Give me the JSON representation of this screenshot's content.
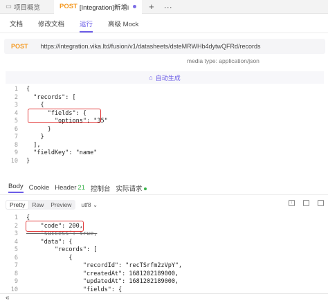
{
  "tabs": [
    {
      "label": "项目概览"
    },
    {
      "method": "POST",
      "label": "[Integration]新增i"
    }
  ],
  "tabbar": {
    "plus": "+",
    "more": "···"
  },
  "subnav": [
    "文档",
    "修改文档",
    "运行",
    "高级 Mock"
  ],
  "request": {
    "method": "POST",
    "url": "https://integration.vika.ltd/fusion/v1/datasheets/dsteMRWHb4dytwQFRd/records",
    "media_type": "media type: application/json",
    "autogen": "自动生成"
  },
  "request_body": [
    {
      "n": "1",
      "t": "{"
    },
    {
      "n": "2",
      "t": "  \"records\": ["
    },
    {
      "n": "3",
      "t": "    {"
    },
    {
      "n": "4",
      "t": "      \"fields\": {"
    },
    {
      "n": "5",
      "t": "        \"options\": \"35\""
    },
    {
      "n": "6",
      "t": "      }"
    },
    {
      "n": "7",
      "t": "    }"
    },
    {
      "n": "8",
      "t": "  ],"
    },
    {
      "n": "9",
      "t": "  \"fieldKey\": \"name\""
    },
    {
      "n": "10",
      "t": "}"
    }
  ],
  "response_tabs": [
    "Body",
    "Cookie",
    "Header",
    "21",
    "控制台",
    "实际请求"
  ],
  "view_modes": [
    "Pretty",
    "Raw",
    "Preview"
  ],
  "encoding": "utf8",
  "response_body": [
    {
      "n": "1",
      "t": "{"
    },
    {
      "n": "2",
      "t": "    \"code\": 200,"
    },
    {
      "n": "3",
      "t": "    \"success\": true,"
    },
    {
      "n": "4",
      "t": "    \"data\": {"
    },
    {
      "n": "5",
      "t": "        \"records\": ["
    },
    {
      "n": "6",
      "t": "            {"
    },
    {
      "n": "7",
      "t": "                \"recordId\": \"recTSrfm2zVpY\","
    },
    {
      "n": "8",
      "t": "                \"createdAt\": 1681202189000,"
    },
    {
      "n": "9",
      "t": "                \"updatedAt\": 1681202189000,"
    },
    {
      "n": "10",
      "t": "                \"fields\": {"
    }
  ],
  "footer": {
    "collapse": "«"
  },
  "colors": {
    "accent": "#6b5ce7",
    "method": "#f59a23",
    "highlight": "#e23b3b",
    "success": "#39b24a"
  }
}
